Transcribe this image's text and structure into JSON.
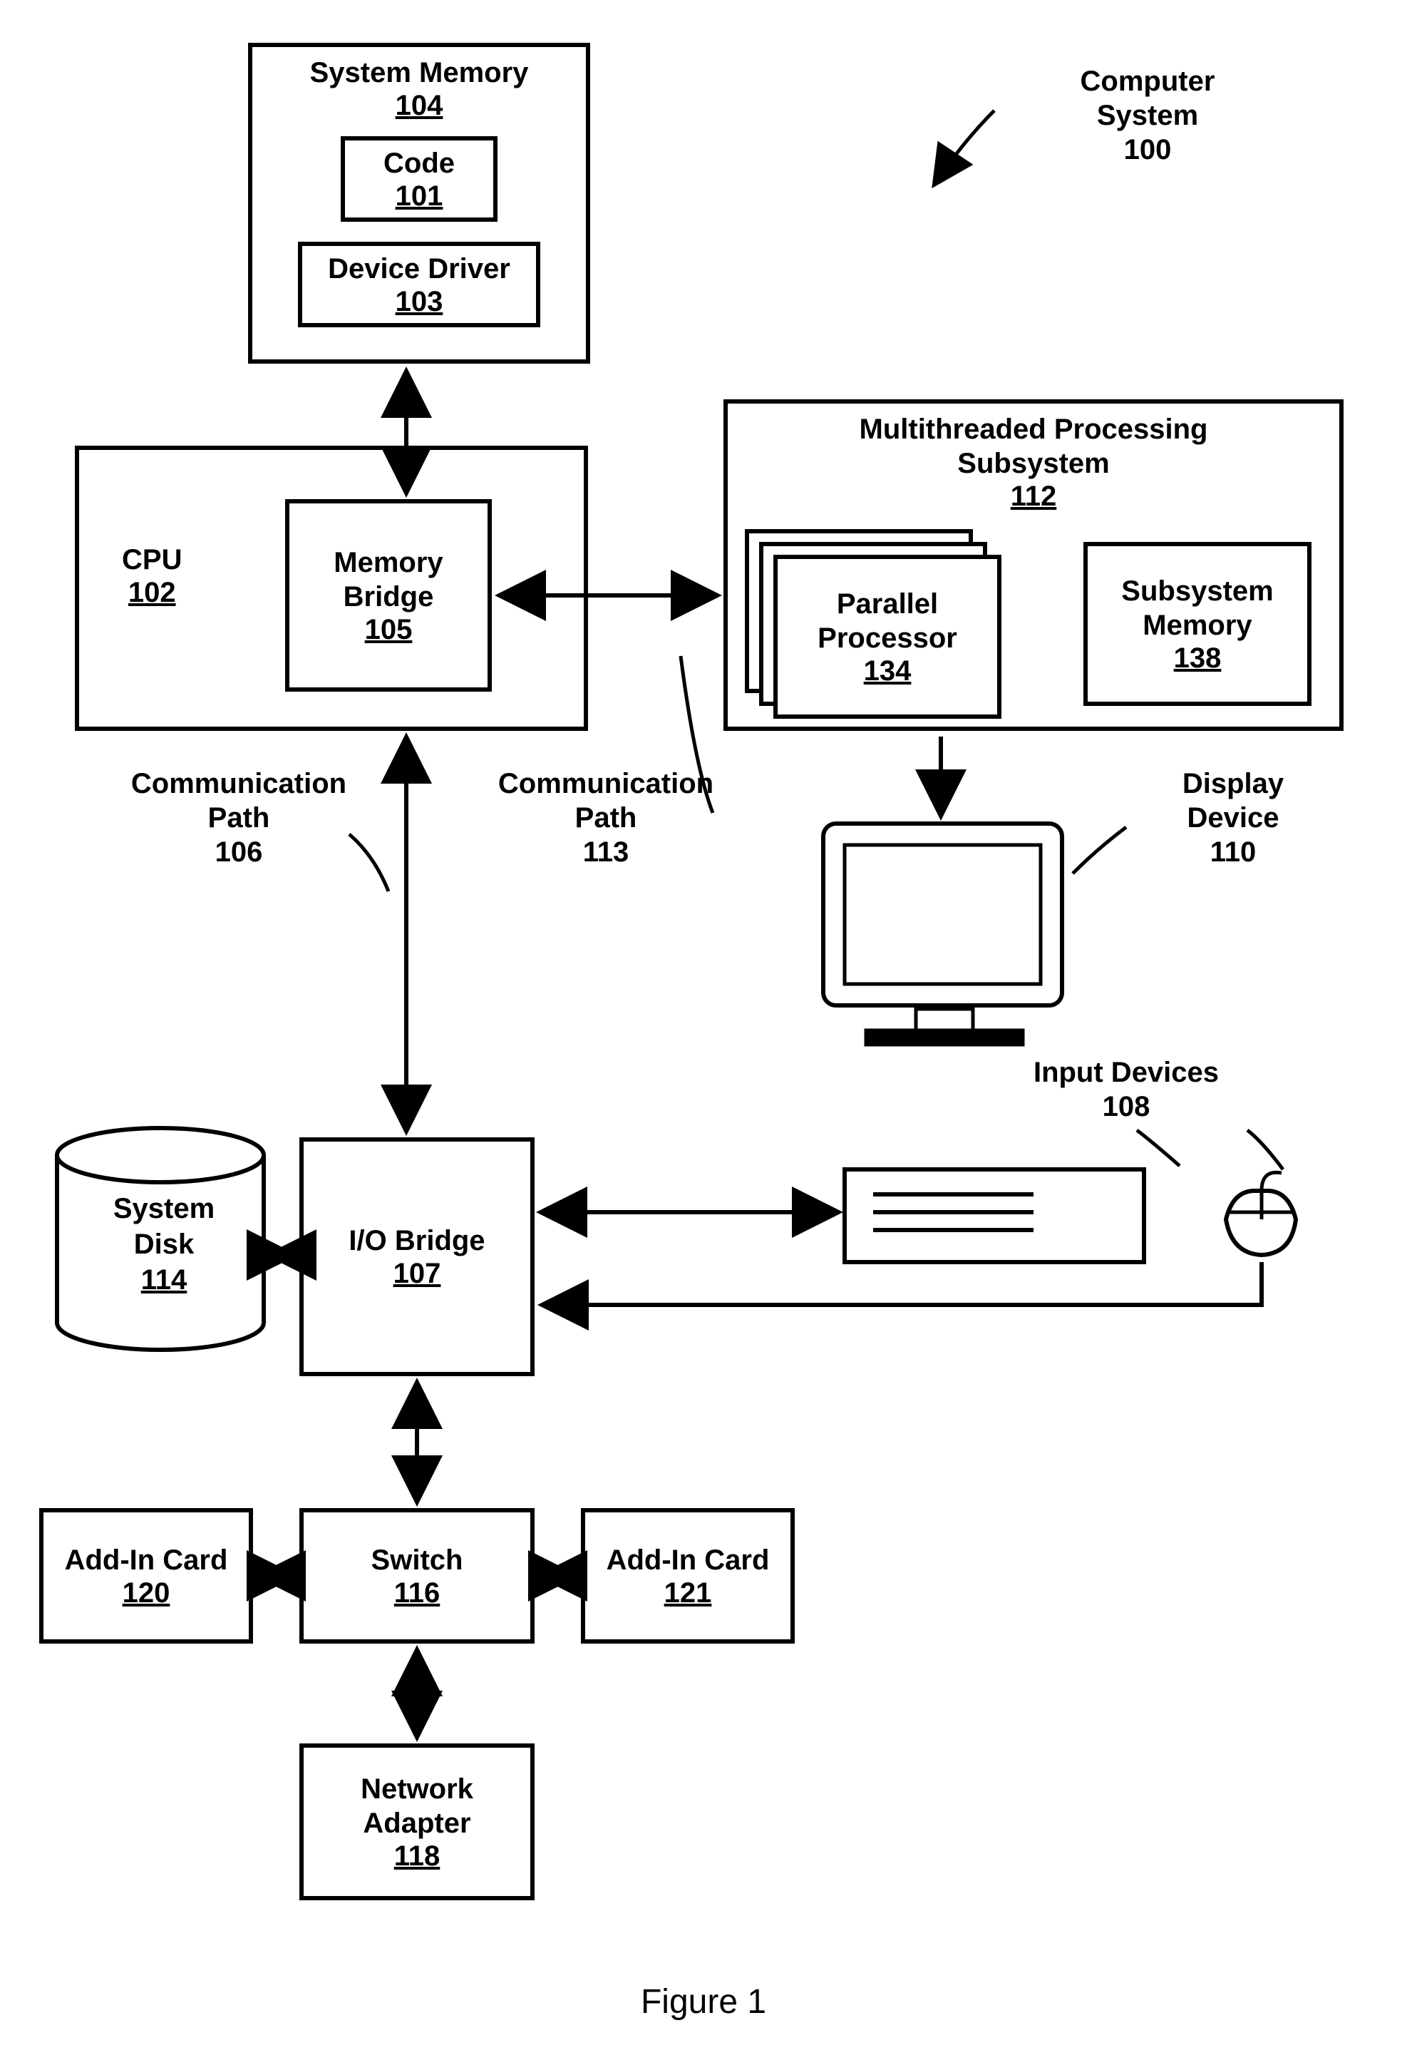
{
  "blocks": {
    "system_memory": {
      "title": "System Memory",
      "num": "104"
    },
    "code": {
      "title": "Code",
      "num": "101"
    },
    "device_driver": {
      "title": "Device Driver",
      "num": "103"
    },
    "computer_system": {
      "title": "Computer\nSystem",
      "num": "100"
    },
    "cpu": {
      "title": "CPU",
      "num": "102"
    },
    "memory_bridge": {
      "title": "Memory\nBridge",
      "num": "105"
    },
    "mtps": {
      "title": "Multithreaded Processing\nSubsystem",
      "num": "112"
    },
    "parallel_processor": {
      "title": "Parallel\nProcessor",
      "num": "134"
    },
    "subsystem_memory": {
      "title": "Subsystem\nMemory",
      "num": "138"
    },
    "comm_path_106": {
      "title": "Communication\nPath",
      "num": "106"
    },
    "comm_path_113": {
      "title": "Communication\nPath",
      "num": "113"
    },
    "display_device": {
      "title": "Display\nDevice",
      "num": "110"
    },
    "input_devices": {
      "title": "Input Devices",
      "num": "108"
    },
    "system_disk": {
      "title": "System\nDisk",
      "num": "114"
    },
    "io_bridge": {
      "title": "I/O Bridge",
      "num": "107"
    },
    "add_in_120": {
      "title": "Add-In Card",
      "num": "120"
    },
    "switch": {
      "title": "Switch",
      "num": "116"
    },
    "add_in_121": {
      "title": "Add-In Card",
      "num": "121"
    },
    "network_adapter": {
      "title": "Network\nAdapter",
      "num": "118"
    }
  },
  "figure_caption": "Figure 1"
}
